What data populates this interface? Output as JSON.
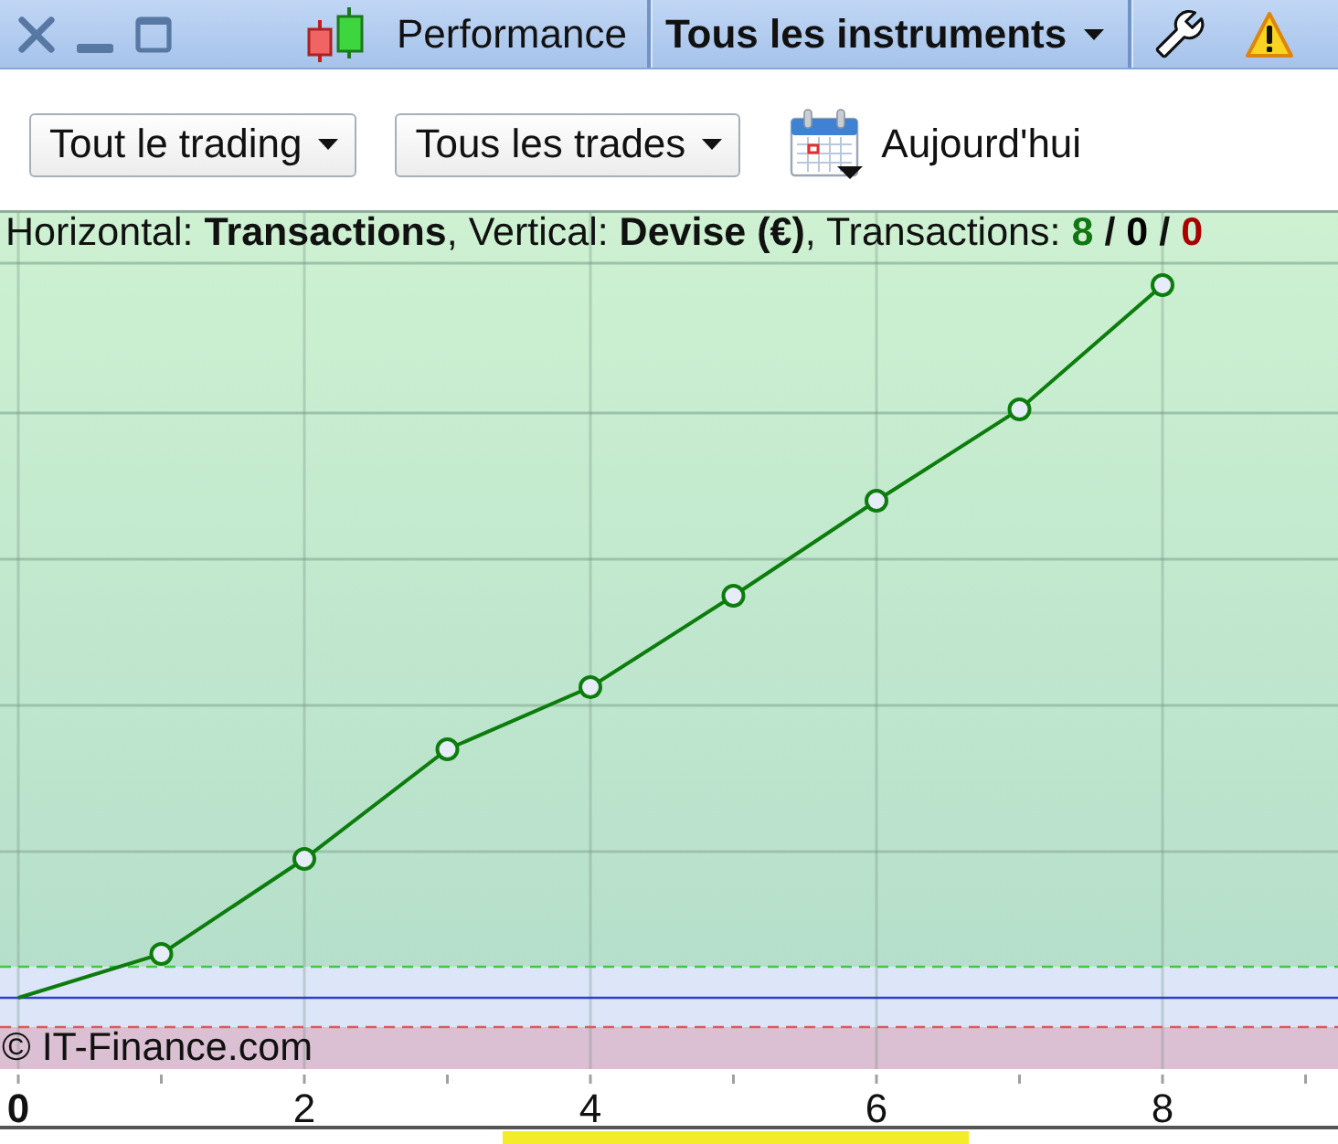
{
  "window": {
    "title": "Performance",
    "instrument_filter": "Tous les instruments"
  },
  "toolbar": {
    "filters": [
      "Tout le trading",
      "Tous les trades"
    ],
    "date_range": "Aujourd'hui"
  },
  "chart": {
    "caption": "Horizontal: **Transactions**, Vertical: **Devise (€)**, Transactions:",
    "counts": [
      {
        "value": "8",
        "color": "#117711"
      },
      {
        "separator_before": "/",
        "value": "0",
        "color": "#000000"
      },
      {
        "separator_before": "/",
        "value": "0",
        "color": "#aa0000"
      }
    ],
    "credit": "© IT-Finance.com",
    "x_labels": [
      {
        "label": "0",
        "emphasized": true
      },
      {
        "label": "2",
        "emphasized": false
      },
      {
        "label": "4",
        "emphasized": false
      },
      {
        "label": "6",
        "emphasized": false
      },
      {
        "label": "8",
        "emphasized": false
      }
    ]
  }
}
